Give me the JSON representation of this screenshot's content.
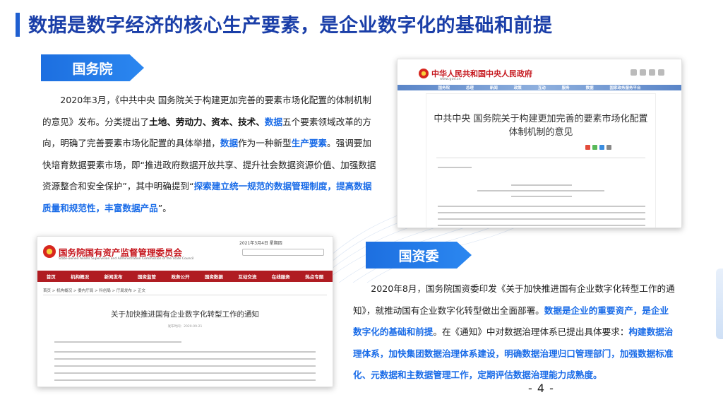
{
  "page": {
    "title": "数据是数字经济的核心生产要素，是企业数字化的基础和前提",
    "page_number": "- 4 -"
  },
  "section1": {
    "tag": "国务院",
    "text": [
      {
        "t": "2020年3月，《中共中央 国务院关于构建更加完善的要素市场化配置的体制机制的意见》发布。分类提出了",
        "s": "n"
      },
      {
        "t": "土地、劳动力、资本、技术、",
        "s": "b"
      },
      {
        "t": "数据",
        "s": "blue"
      },
      {
        "t": "五个要素领域改革的方向，明确了完善要素市场化配置的具体举措，",
        "s": "n"
      },
      {
        "t": "数据",
        "s": "blue"
      },
      {
        "t": "作为一种新型",
        "s": "n"
      },
      {
        "t": "生产要素",
        "s": "blue"
      },
      {
        "t": "。强调要加快培育数据要素市场，即“推进政府数据开放共享、提升社会数据资源价值、加强数据资源整合和安全保护”，其中明确提到“",
        "s": "n"
      },
      {
        "t": "探索建立统一规范的数据管理制度，提高数据质量和规范性，丰富数据产品",
        "s": "blue"
      },
      {
        "t": "”。",
        "s": "n"
      }
    ]
  },
  "section2": {
    "tag": "国资委",
    "text": [
      {
        "t": "2020年8月，国务院国资委印发《关于加快推进国有企业数字化转型工作的通知》，就推动国有企业数字化转型做出全面部署。",
        "s": "n"
      },
      {
        "t": "数据是企业的重要资产，是企业数字化的基础和前提",
        "s": "blue"
      },
      {
        "t": "。在《通知》中对数据治理体系已提出具体要求：",
        "s": "n"
      },
      {
        "t": "构建数据治理体系，加快集团数据治理体系建设，明确数据治理归口管理部门，加强数据标准化、元数据和主数据管理工作，定期评估数据治理能力成熟度。",
        "s": "blue"
      }
    ]
  },
  "shot_gov": {
    "site_name": "中华人民共和国中央人民政府",
    "url": "www.gov.cn",
    "nav": [
      "国务院",
      "总理",
      "新闻",
      "政策",
      "互动",
      "服务",
      "数据",
      "国家政务服务平台"
    ],
    "article_title_1": "中共中央 国务院关于构建更加完善的要素市场化配置",
    "article_title_2": "体制机制的意见"
  },
  "shot_sasac": {
    "site_name": "国务院国有资产监督管理委员会",
    "site_name_en": "State-owned Assets Supervision and Administration Commission of the State Council",
    "date": "2021年3月4日 星期四",
    "nav": [
      "首页",
      "机构概况",
      "新闻发布",
      "国资监管",
      "政务公开",
      "国资数据",
      "互动交流",
      "在线服务",
      "热点专题"
    ],
    "breadcrumb": "首页 > 机构概况 > 委内厅局 > 科创局 > 厅局发布 > 正文",
    "article_title": "关于加快推进国有企业数字化转型工作的通知",
    "article_date": "发布时间：2020-09-21"
  },
  "colors": {
    "accent": "#1a6ce8",
    "title": "#1a3ea8",
    "gov_red": "#c5161d"
  }
}
